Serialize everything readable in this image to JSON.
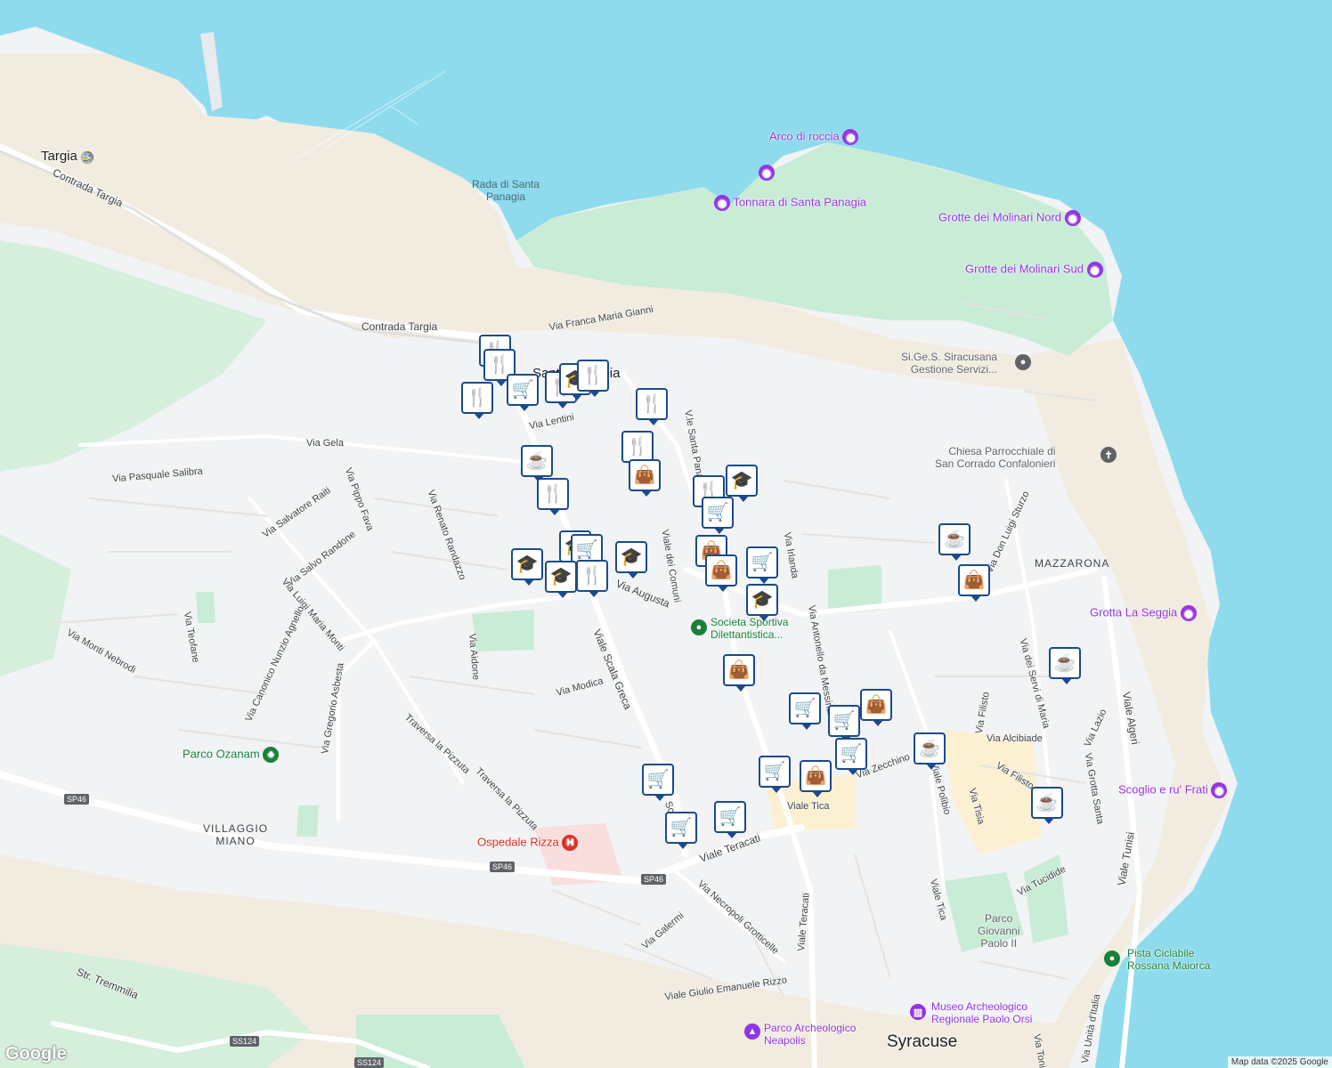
{
  "colors": {
    "water": "#8edbee",
    "land": "#f1f3f4",
    "park": "#c8ecd6",
    "sand": "#f1ecdf",
    "pin_border": "#1a4a8a",
    "pin_fill": "#ffffff",
    "road": "#ffffff",
    "purple": "#9334e6",
    "green": "#188038",
    "red": "#d93025"
  },
  "water_labels": [
    {
      "id": "rada",
      "text": "Rada di Santa\nPanagia"
    }
  ],
  "streets": {
    "contrada_targia_1": "Contrada Targia",
    "contrada_targia_2": "Contrada Targia",
    "via_franca": "Via Franca Maria Gianni",
    "via_lentini": "Via Lentini",
    "via_gela": "Via Gela",
    "via_pasquale": "Via Pasquale Salibra",
    "via_salvatore": "Via Salvatore Raiti",
    "via_pippo": "Via Pippo Fava",
    "via_salvo": "Via Salvo Randone",
    "via_renato": "Via Renato Randazzo",
    "via_luigi": "Via Luigi Maria Monti",
    "via_canonico": "Via Canonico Nunzio Agnello",
    "via_gregorio": "Via Gregorio Asbesta",
    "via_teofane": "Via Teofane",
    "via_monti": "Via Monti Nebrodi",
    "via_aidone": "Via Aidone",
    "via_modica": "Via Modica",
    "traversa_1": "Traversa la Pizzuta",
    "traversa_2": "Traversa la Pizzuta",
    "viale_scala": "Viale Scala Greca",
    "viale_sc_short": "Sca...reca",
    "via_augusta": "Via Augusta",
    "viale_comuni": "Viale dei Comuni",
    "vle_santa": "V.le Santa Panag.",
    "via_irlanda": "Via Irlanda",
    "via_antonello": "Via Antonello da Messina",
    "viale_teracati": "Viale Teracati",
    "viale_teracati_v": "Viale Teracati",
    "via_galermi": "Via Galermi",
    "via_necropoli": "Via Necropoli Grotticelle",
    "viale_giulio": "Viale Giulio Emanuele Rizzo",
    "viale_tica": "Viale Tica",
    "viale_tica_v": "Viale Tica",
    "via_zecchino": "Via Zecchino",
    "viale_polibio": "Viale Polibio",
    "via_tisia": "Via Tisia",
    "via_filisto": "Via Filisto",
    "via_filisto_2": "Via Filisto",
    "via_alcibiade": "Via Alcibiade",
    "via_servi": "Via dei Servi di Maria",
    "via_grotta": "Via Grotta Santa",
    "via_lazio": "Via Lazio",
    "viale_algeri": "Viale Algeri",
    "viale_tunisi": "Viale Tunisi",
    "via_tucidide": "Via Tucidide",
    "via_don_luigi": "Via Don Luigi Sturzo",
    "str_tremmilia": "Str. Tremmilia",
    "via_unita": "Via Unità d'Italia",
    "via_toni": "Via Toni",
    "viale_ue": "Viale Ue",
    "via_short": "Via",
    "viale_sc2": "Viale"
  },
  "places": {
    "targia": "Targia",
    "santa_panagia": "Santa Panagia",
    "mazzarona": "MAZZARONA",
    "villaggio_miano": "VILLAGGIO\nMIANO",
    "syracuse": "Syracuse",
    "parco_giovanni": "Parco\nGiovanni\nPaolo II"
  },
  "pois": {
    "arco": "Arco di roccia",
    "tonnara": "Tonnara di Santa Panagia",
    "grotte_nord": "Grotte dei Molinari Nord",
    "grotte_sud": "Grotte dei Molinari Sud",
    "sigess": "Si.Ge.S. Siracusana\nGestione Servizi...",
    "chiesa": "Chiesa Parrocchiale di\nSan Corrado Confalonieri",
    "grotta_seggia": "Grotta La Seggia",
    "scoglio": "Scoglio e ru' Frati",
    "societa": "Societa Sportiva\nDilettantistica...",
    "parco_ozanam": "Parco Ozanam",
    "ospedale": "Ospedale Rizza",
    "parco_arch": "Parco Archeologico\nNeapolis",
    "museo": "Museo Archeologico\nRegionale Paolo Orsi",
    "pista": "Pista Ciclabile\nRossana Maiorca"
  },
  "road_shields": [
    "SP46",
    "SP46",
    "SP46",
    "SS124",
    "SS124"
  ],
  "markers": [
    {
      "type": "restaurant-icon",
      "glyph": "🍴"
    },
    {
      "type": "restaurant-icon",
      "glyph": "🍴"
    },
    {
      "type": "restaurant-icon",
      "glyph": "🍴"
    },
    {
      "type": "shopping-cart-icon",
      "glyph": "🛒"
    },
    {
      "type": "restaurant-icon",
      "glyph": "🍴"
    },
    {
      "type": "school-icon",
      "glyph": "🎓"
    },
    {
      "type": "restaurant-icon",
      "glyph": "🍴"
    },
    {
      "type": "restaurant-icon",
      "glyph": "🍴"
    },
    {
      "type": "restaurant-icon",
      "glyph": "🍴"
    },
    {
      "type": "cafe-icon",
      "glyph": "☕"
    },
    {
      "type": "shopping-bag-icon",
      "glyph": "👜"
    },
    {
      "type": "restaurant-icon",
      "glyph": "🍴"
    },
    {
      "type": "restaurant-icon",
      "glyph": "🍴"
    },
    {
      "type": "school-icon",
      "glyph": "🎓"
    },
    {
      "type": "shopping-cart-icon",
      "glyph": "🛒"
    },
    {
      "type": "school-icon",
      "glyph": "🎓"
    },
    {
      "type": "shopping-cart-icon",
      "glyph": "🛒"
    },
    {
      "type": "school-icon",
      "glyph": "🎓"
    },
    {
      "type": "restaurant-icon",
      "glyph": "🍴"
    },
    {
      "type": "school-icon",
      "glyph": "🎓"
    },
    {
      "type": "shopping-bag-icon",
      "glyph": "👜"
    },
    {
      "type": "shopping-cart-icon",
      "glyph": "🛒"
    },
    {
      "type": "shopping-bag-icon",
      "glyph": "👜"
    },
    {
      "type": "school-icon",
      "glyph": "🎓"
    },
    {
      "type": "school-icon",
      "glyph": "🎓"
    },
    {
      "type": "shopping-bag-icon",
      "glyph": "👜"
    },
    {
      "type": "cafe-icon",
      "glyph": "☕"
    },
    {
      "type": "shopping-bag-icon",
      "glyph": "👜"
    },
    {
      "type": "cafe-icon",
      "glyph": "☕"
    },
    {
      "type": "shopping-cart-icon",
      "glyph": "🛒"
    },
    {
      "type": "shopping-cart-icon",
      "glyph": "🛒"
    },
    {
      "type": "shopping-bag-icon",
      "glyph": "👜"
    },
    {
      "type": "shopping-cart-icon",
      "glyph": "🛒"
    },
    {
      "type": "cafe-icon",
      "glyph": "☕"
    },
    {
      "type": "shopping-cart-icon",
      "glyph": "🛒"
    },
    {
      "type": "shopping-bag-icon",
      "glyph": "👜"
    },
    {
      "type": "cafe-icon",
      "glyph": "☕"
    },
    {
      "type": "shopping-cart-icon",
      "glyph": "🛒"
    },
    {
      "type": "shopping-cart-icon",
      "glyph": "🛒"
    },
    {
      "type": "shopping-cart-icon",
      "glyph": "🛒"
    }
  ],
  "attribution": "Map data ©2025 Google",
  "logo": "Google"
}
